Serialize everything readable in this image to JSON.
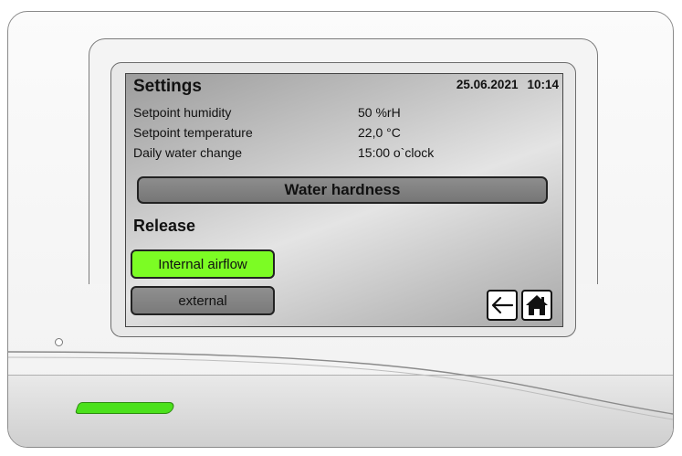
{
  "screen": {
    "title": "Settings",
    "date": "25.06.2021",
    "time": "10:14",
    "rows": [
      {
        "label": "Setpoint humidity",
        "value": "50 %rH"
      },
      {
        "label": "Setpoint temperature",
        "value": "22,0 °C"
      },
      {
        "label": "Daily water change",
        "value": "15:00 o`clock"
      }
    ],
    "water_hardness_label": "Water hardness",
    "release_heading": "Release",
    "release_options": [
      {
        "label": "Internal airflow",
        "selected": true
      },
      {
        "label": "external",
        "selected": false
      }
    ],
    "nav": {
      "back_icon": "arrow-left-icon",
      "home_icon": "home-icon"
    }
  },
  "colors": {
    "selected_button": "#7cfc24",
    "unselected_button": "#7f7f7f",
    "status_led": "#4be11c"
  }
}
